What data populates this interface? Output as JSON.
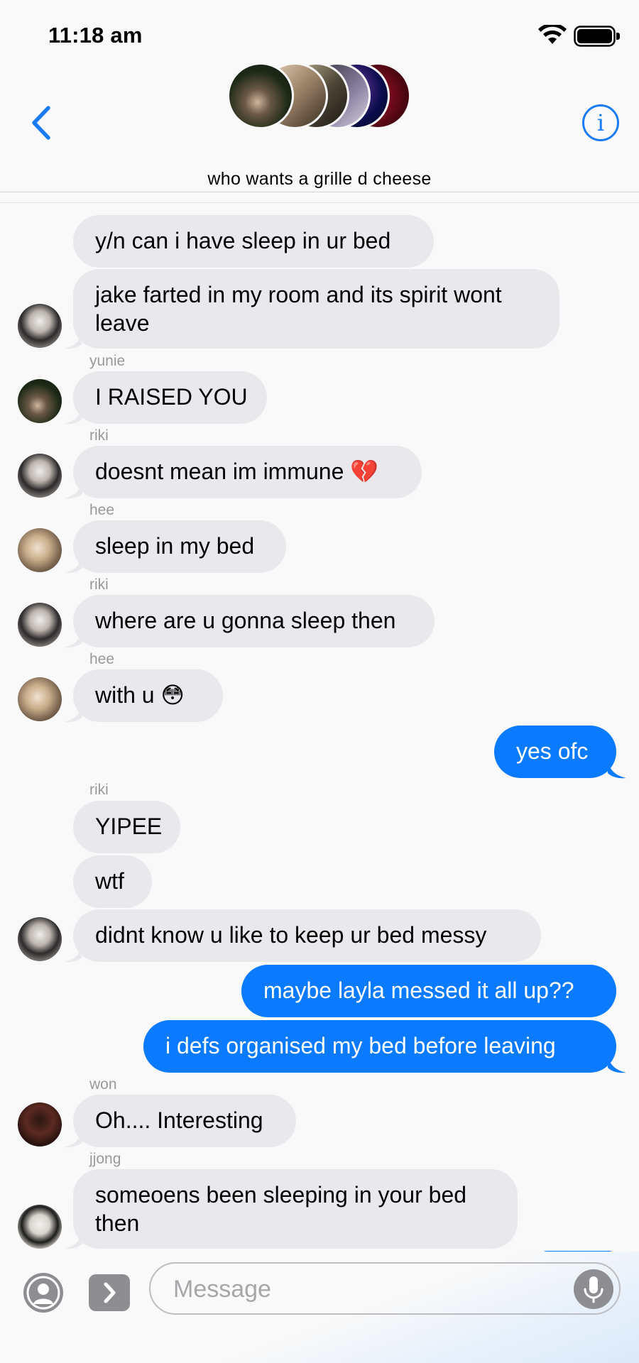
{
  "status_bar": {
    "time": "11:18 am"
  },
  "header": {
    "title": "who wants a grille d cheese",
    "info_label": "i"
  },
  "messages": [
    {
      "text": "y/n can i have sleep in ur bed"
    },
    {
      "text": "jake farted in my room and its spirit wont leave"
    },
    {
      "sender": "yunie",
      "text": "I RAISED YOU"
    },
    {
      "sender": "riki",
      "text": "doesnt mean im immune 💔"
    },
    {
      "sender": "hee",
      "text": "sleep in my bed"
    },
    {
      "sender": "riki",
      "text": "where are u gonna sleep then"
    },
    {
      "sender": "hee",
      "text": "with u 😳"
    },
    {
      "text": "yes ofc"
    },
    {
      "sender": "riki",
      "text": "YIPEE"
    },
    {
      "text": "wtf"
    },
    {
      "text": "didnt know u like to keep ur bed messy"
    },
    {
      "text": "maybe layla messed it all up??"
    },
    {
      "text": "i defs organised my bed before leaving"
    },
    {
      "sender": "won",
      "text": "Oh.... Interesting"
    },
    {
      "sender": "jjong",
      "text": "someoens been sleeping in your bed then"
    }
  ],
  "input": {
    "placeholder": "Message"
  },
  "colors": {
    "accent": "#0a7aff",
    "bubble_received": "#e9e8ed",
    "background": "#f9f9f9"
  }
}
